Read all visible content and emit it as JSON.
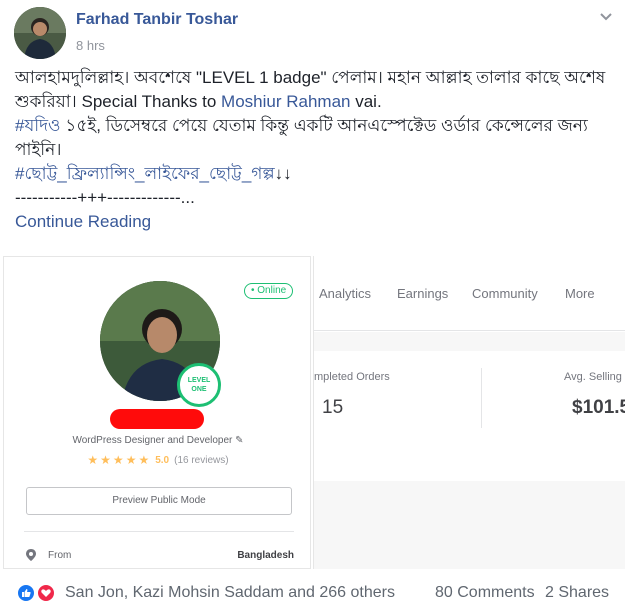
{
  "post": {
    "author": "Farhad Tanbir Toshar",
    "time": "8 hrs",
    "line1_a": "আলহামদুলিল্লাহ। অবশেষে \"LEVEL 1 badge\" পেলাম। মহান আল্লাহ তালার কাছে অশেষ শুকরিয়া। Special Thanks to ",
    "mention": "Moshiur Rahman",
    "line1_b": " vai.",
    "hashtag1": "#যদিও",
    "line2": " ১৫ই, ডিসেম্বরে পেয়ে যেতাম কিন্তু একটি আনএস্পেক্টেড ওর্ডার কেন্সেলের জন্য পাইনি।",
    "hashtag2": "#ছোট্ট_ফ্রিল্যান্সিং_লাইফের_ছোট্ট_গল্প",
    "arrows": "↓↓",
    "separator": "-----------+++-------------...",
    "continue": "Continue Reading"
  },
  "profile_card": {
    "online": "• Online",
    "level_line1": "LEVEL",
    "level_line2": "ONE",
    "tagline": "WordPress Designer and Developer ✎",
    "rating_value": "5.0",
    "rating_count": "(16 reviews)",
    "preview_button": "Preview Public Mode",
    "from_label": "From",
    "from_value": "Bangladesh",
    "stars": 5
  },
  "dashboard": {
    "nav": [
      "Analytics",
      "Earnings",
      "Community",
      "More"
    ],
    "stat1_label": "mpleted Orders",
    "stat1_value": "15",
    "stat2_label": "Avg. Selling",
    "stat2_value": "$101.5"
  },
  "footer": {
    "reactors": "San Jon, Kazi Mohsin Saddam and 266 others",
    "comments": "80 Comments",
    "shares": "2 Shares"
  },
  "colors": {
    "link": "#385898",
    "fiverr_green": "#1dbf73",
    "star": "#ffbe5b",
    "like_blue": "#1877f2",
    "love_red": "#f0284a"
  }
}
